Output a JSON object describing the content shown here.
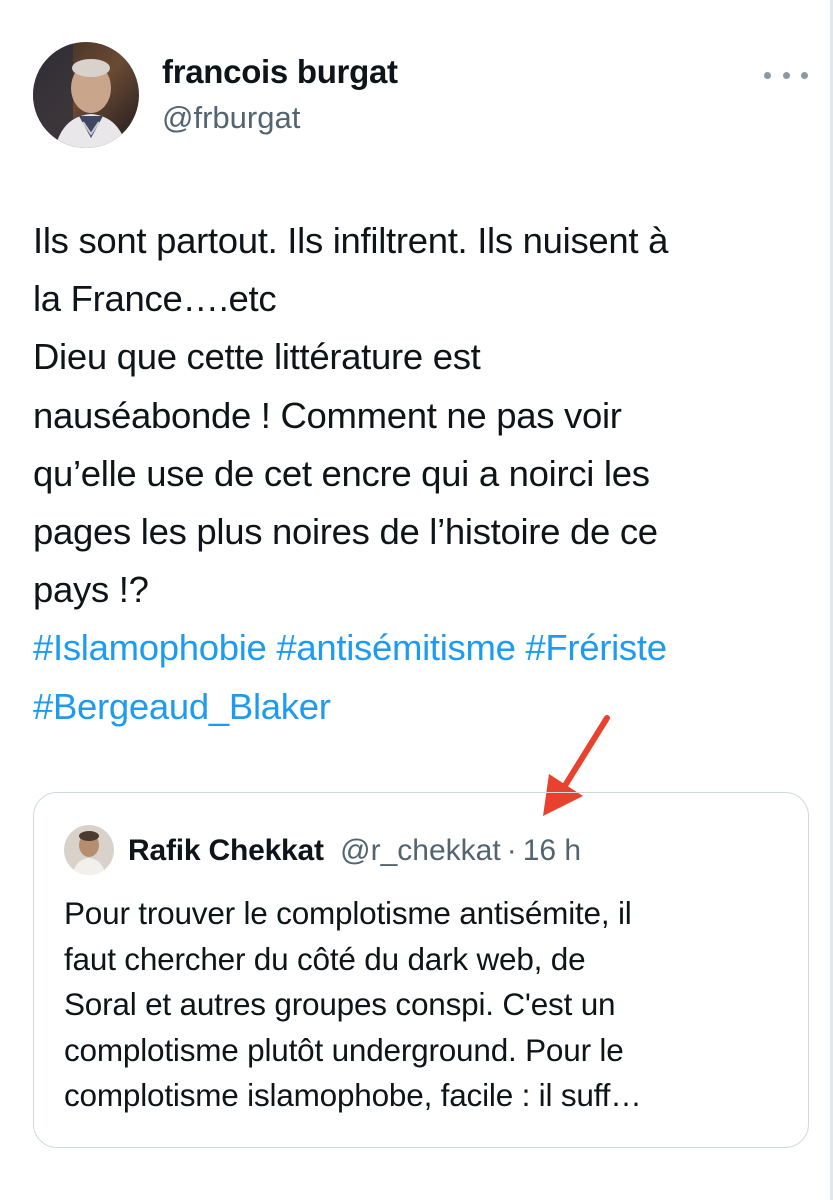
{
  "tweet": {
    "author": {
      "display_name": "francois burgat",
      "handle": "@frburgat",
      "avatar_icon": "user-avatar-photo"
    },
    "more_icon": "more-horizontal-icon",
    "text_lines": [
      "Ils sont partout. Ils infiltrent. Ils nuisent à",
      "la France….etc",
      "Dieu que cette littérature est",
      "nauséabonde ! Comment ne pas voir",
      "qu’elle use de cet encre qui a noirci  les",
      "pages les plus noires de l’histoire de ce",
      "pays !?"
    ],
    "hashtags": [
      "#Islamophobie",
      "#antisémitisme",
      "#Fréristе",
      "#Bergeaud_Blaker"
    ],
    "hashtag_color": "#1d9bf0"
  },
  "annotation": {
    "arrow_color": "#e8412d"
  },
  "quoted_tweet": {
    "author": {
      "display_name": "Rafik Chekkat",
      "handle": "@r_chekkat",
      "separator": "·",
      "time": "16 h"
    },
    "text_lines": [
      "Pour trouver le complotisme antisémite, il",
      "faut chercher du côté du dark web, de",
      "Soral et autres groupes conspi. C'est un",
      "complotisme plutôt underground. Pour le",
      "complotisme islamophobe, facile : il suff…"
    ]
  }
}
